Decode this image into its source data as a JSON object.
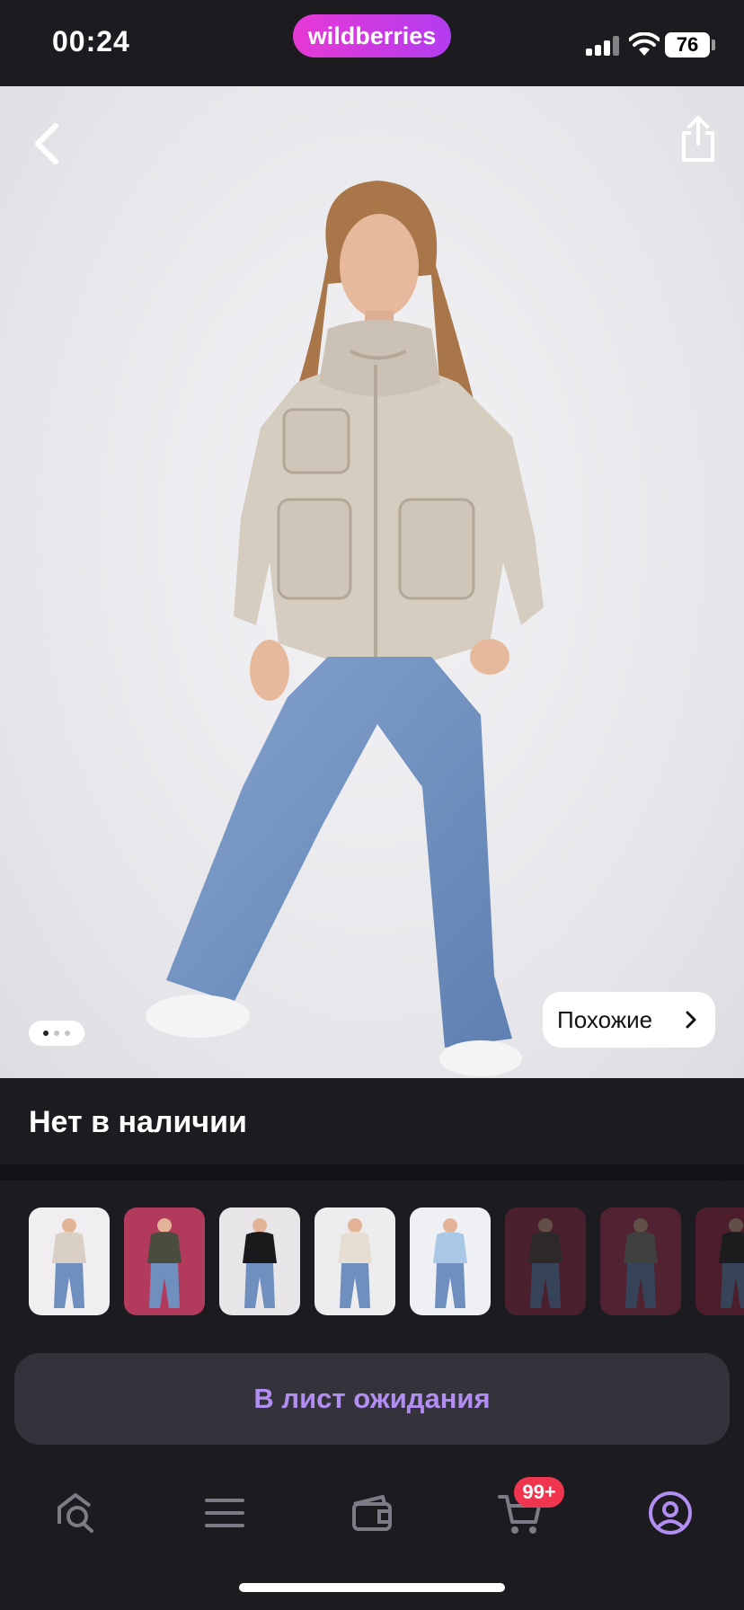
{
  "status_bar": {
    "time": "00:24",
    "brand": "wildberries",
    "battery": "76"
  },
  "product": {
    "similar_label": "Похожие",
    "gallery_page": 1,
    "gallery_total": 3,
    "availability": "Нет в наличии"
  },
  "variants": [
    {
      "name": "beige-jacket",
      "jacket": "#d9cfc4",
      "bg": "#f0eef0",
      "dim": false
    },
    {
      "name": "khaki-coat",
      "jacket": "#4a4d3e",
      "bg": "#b23a5c",
      "dim": false
    },
    {
      "name": "black-jacket",
      "jacket": "#1a1a1c",
      "bg": "#e8e6e8",
      "dim": false
    },
    {
      "name": "cream-jacket",
      "jacket": "#e6ddd3",
      "bg": "#ededf0",
      "dim": false
    },
    {
      "name": "light-blue-jacket",
      "jacket": "#a9c8e6",
      "bg": "#eef0f3",
      "dim": false
    },
    {
      "name": "brown-coat",
      "jacket": "#5a4e44",
      "bg": "#a33654",
      "dim": true
    },
    {
      "name": "grey-coat",
      "jacket": "#8c8a84",
      "bg": "#b23a5c",
      "dim": true
    },
    {
      "name": "dark-coat",
      "jacket": "#2a2a2c",
      "bg": "#a8304e",
      "dim": true
    }
  ],
  "actions": {
    "waitlist_label": "В лист ожидания"
  },
  "nav": {
    "items": [
      "search-home",
      "catalog",
      "wallet",
      "cart",
      "profile"
    ],
    "cart_badge": "99+",
    "active": "profile"
  },
  "colors": {
    "accent": "#b28df2",
    "badge": "#f0354e",
    "brand_start": "#e639d4",
    "brand_end": "#b23cf0"
  }
}
